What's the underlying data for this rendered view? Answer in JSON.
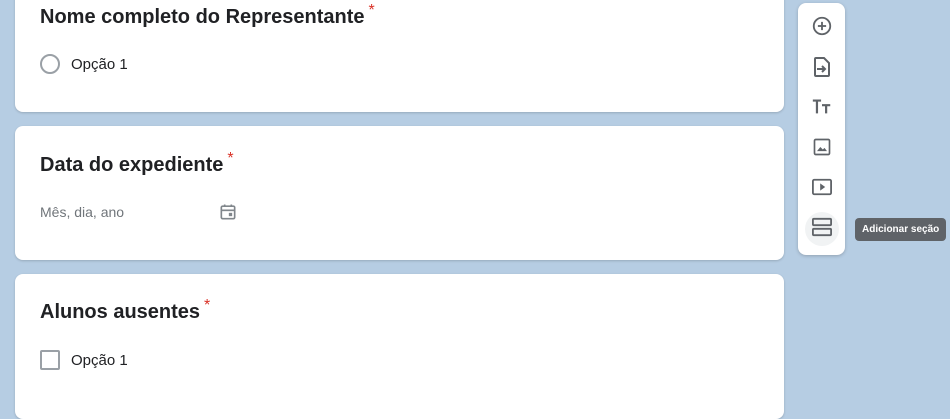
{
  "questions": [
    {
      "title": "Nome completo do Representante",
      "required_mark": "*",
      "type": "radio",
      "option": "Opção 1"
    },
    {
      "title": "Data do expediente",
      "required_mark": "*",
      "type": "date",
      "placeholder": "Mês, dia, ano"
    },
    {
      "title": "Alunos ausentes",
      "required_mark": "*",
      "type": "checkbox",
      "option": "Opção 1"
    }
  ],
  "toolbar": {
    "buttons": [
      {
        "icon": "add-circle-icon"
      },
      {
        "icon": "import-questions-icon"
      },
      {
        "icon": "title-text-icon"
      },
      {
        "icon": "image-icon"
      },
      {
        "icon": "video-icon"
      },
      {
        "icon": "section-icon"
      }
    ],
    "tooltip": "Adicionar seção"
  },
  "colors": {
    "background": "#b6cde3",
    "required": "#d93025",
    "tooltip_bg": "#5f6368"
  }
}
